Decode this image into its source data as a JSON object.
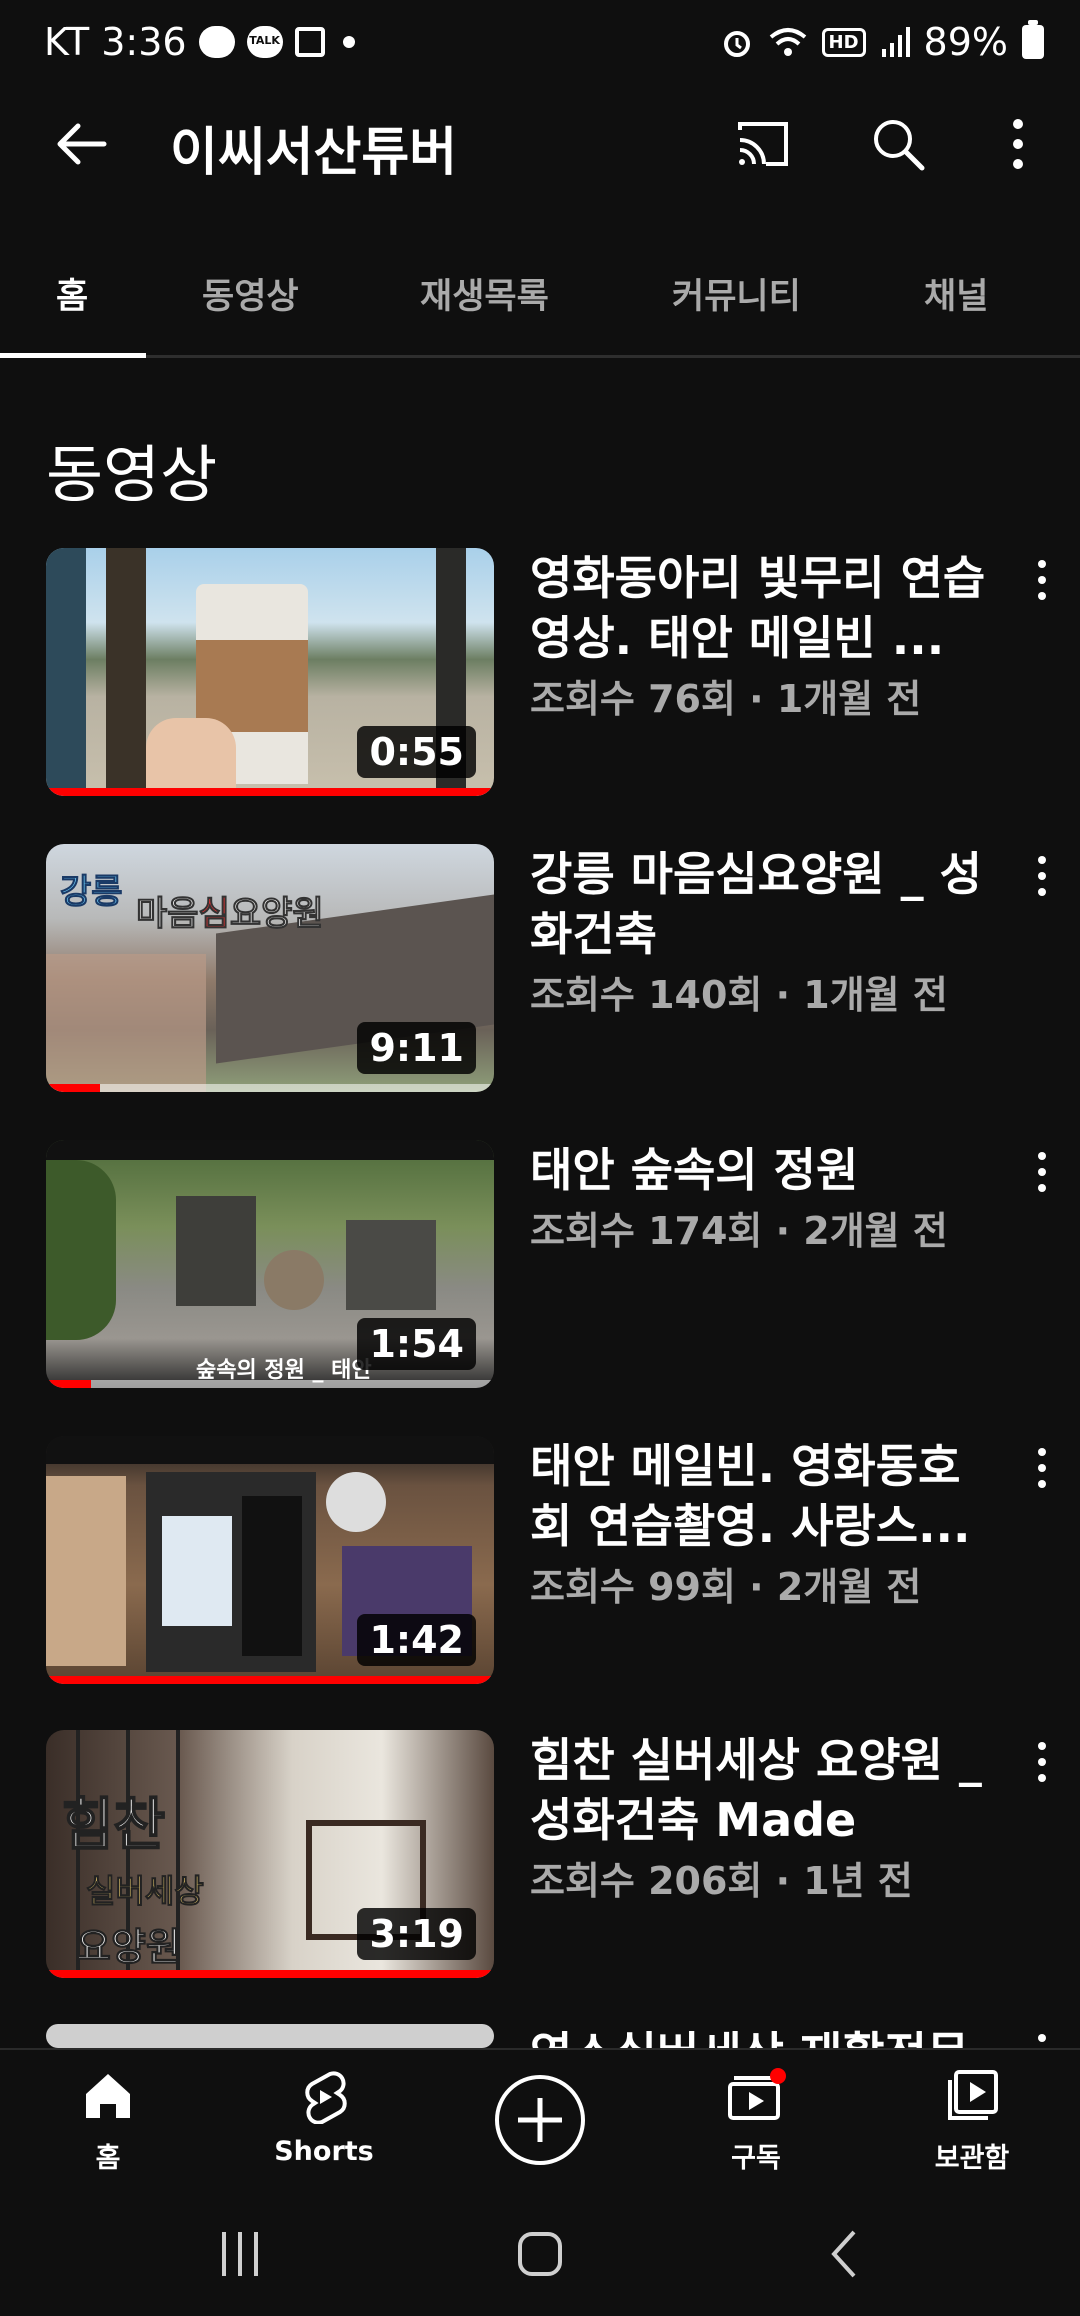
{
  "status_bar": {
    "carrier_time": "KT 3:36",
    "battery": "89%"
  },
  "header": {
    "title": "이씨서산튜버"
  },
  "tabs": [
    {
      "label": "홈",
      "active": true
    },
    {
      "label": "동영상",
      "active": false
    },
    {
      "label": "재생목록",
      "active": false
    },
    {
      "label": "커뮤니티",
      "active": false
    },
    {
      "label": "채널",
      "active": false
    }
  ],
  "section": {
    "title": "동영상"
  },
  "videos": [
    {
      "title": "영화동아리 빛무리 연습영상. 태안 메일빈 ...",
      "meta": "조회수 76회 · 1개월 전",
      "duration": "0:55",
      "progress": 1.0
    },
    {
      "title": "강릉 마음심요양원 _ 성화건축",
      "meta": "조회수 140회 · 1개월 전",
      "duration": "9:11",
      "progress": 0.12,
      "thumb_text": "강릉 마음심요양원"
    },
    {
      "title": "태안 숲속의 정원",
      "meta": "조회수 174회 · 2개월 전",
      "duration": "1:54",
      "progress": 0.1,
      "thumb_text": "숲속의 정원 _ 태안"
    },
    {
      "title": "태안 메일빈. 영화동호회 연습촬영. 사랑스...",
      "meta": "조회수 99회 · 2개월 전",
      "duration": "1:42",
      "progress": 1.0
    },
    {
      "title": "힘찬 실버세상 요양원 _ 성화건축 Made",
      "meta": "조회수 206회 · 1년 전",
      "duration": "3:19",
      "progress": 1.0,
      "thumb_text": "힘찬 실버세상 요양원"
    }
  ],
  "partial_video_title": "영소실버세상 재활전문",
  "bottom_nav": [
    {
      "label": "홈",
      "icon": "home-icon"
    },
    {
      "label": "Shorts",
      "icon": "shorts-icon"
    },
    {
      "label": "",
      "icon": "create-icon"
    },
    {
      "label": "구독",
      "icon": "subscriptions-icon"
    },
    {
      "label": "보관함",
      "icon": "library-icon"
    }
  ],
  "colors": {
    "background": "#0f0f0f",
    "accent": "#ff0000",
    "secondary_text": "#aaaaaa"
  }
}
